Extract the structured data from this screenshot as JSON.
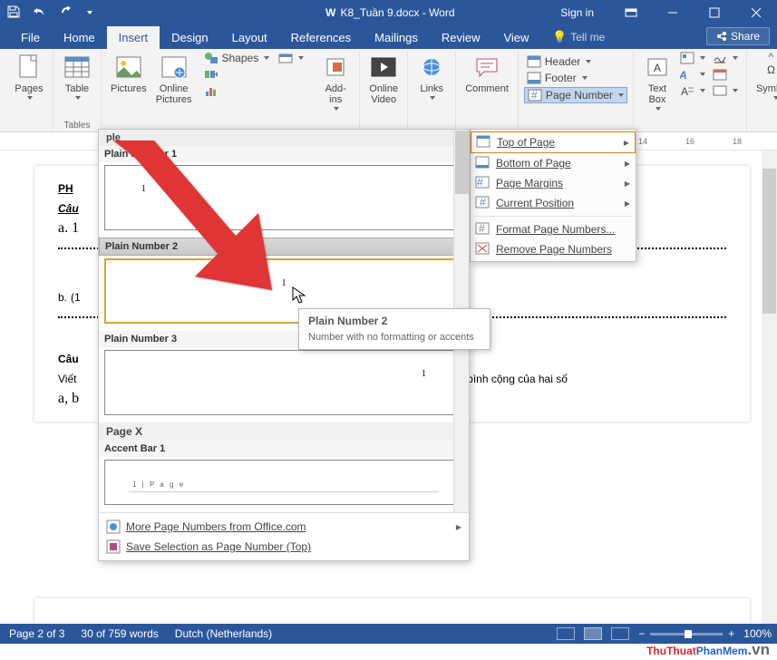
{
  "titlebar": {
    "doc_title": "K8_Tuần 9.docx - Word",
    "sign_in": "Sign in"
  },
  "tabs": {
    "file": "File",
    "home": "Home",
    "insert": "Insert",
    "design": "Design",
    "layout": "Layout",
    "references": "References",
    "mailings": "Mailings",
    "review": "Review",
    "view": "View",
    "tellme": "Tell me",
    "share": "Share"
  },
  "ribbon": {
    "pages": {
      "label": "Pages",
      "group": ""
    },
    "tables": {
      "btn": "Table",
      "group": "Tables"
    },
    "pictures": "Pictures",
    "online_pictures": "Online\nPictures",
    "shapes": "Shapes",
    "addins": "Add-\nins",
    "online_video": "Online\nVideo",
    "links": "Links",
    "comment": "Comment",
    "header": "Header",
    "footer": "Footer",
    "page_number": "Page Number",
    "text_box": "Text\nBox",
    "symbols": "Symbols"
  },
  "page_number_menu": {
    "top": "Top of Page",
    "bottom": "Bottom of Page",
    "margins": "Page Margins",
    "current": "Current Position",
    "format": "Format Page Numbers...",
    "remove": "Remove Page Numbers"
  },
  "gallery": {
    "category": "ple",
    "items": [
      {
        "name": "Plain Number 1"
      },
      {
        "name": "Plain Number 2"
      },
      {
        "name": "Plain Number 3"
      }
    ],
    "category2": "Page X",
    "accent": "Accent Bar 1",
    "accent_preview_text": "1 | P a g e",
    "more": "More Page Numbers from Office.com",
    "save_sel": "Save Selection as Page Number (Top)"
  },
  "tooltip": {
    "title": "Plain Number 2",
    "desc": "Number with no formatting or accents"
  },
  "document": {
    "l1_prefix": "PH",
    "l2_prefix": "Câu",
    "l3": "a. 1",
    "l4": "(1",
    "l4b": "b.",
    "l5": "Câu",
    "l6_pre": "Viết",
    "l6_post": "trung bình cộng của hai số",
    "l7": "a, b"
  },
  "ruler_ticks": [
    "14",
    "16",
    "18"
  ],
  "statusbar": {
    "page": "Page 2 of 3",
    "words": "30 of 759 words",
    "lang": "Dutch (Netherlands)",
    "zoom": "100%"
  },
  "watermark": {
    "t1": "ThuThuat",
    "t2": "PhanMem",
    "t3": ".vn"
  }
}
